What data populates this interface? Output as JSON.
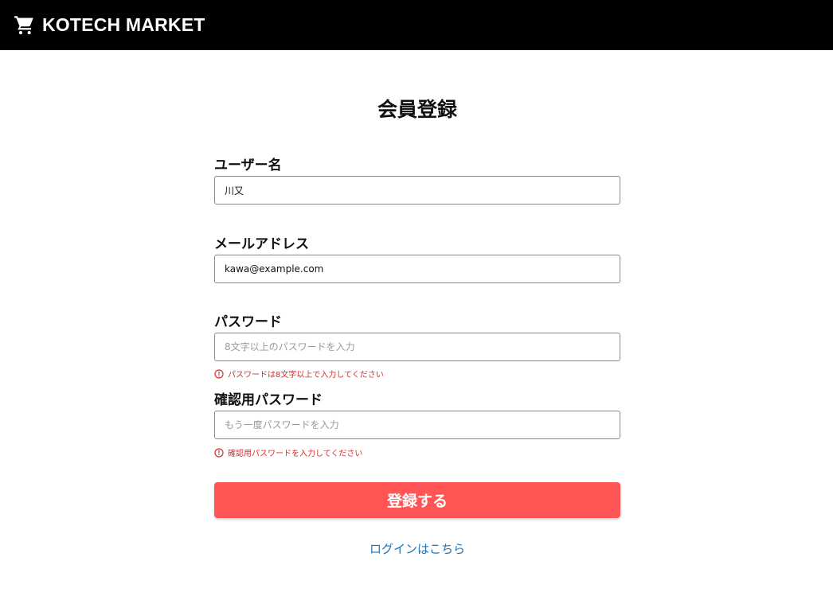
{
  "header": {
    "brand": "KOTECH MARKET",
    "icon": "cart-icon"
  },
  "form": {
    "title": "会員登録",
    "username": {
      "label": "ユーザー名",
      "value": "川又",
      "placeholder": ""
    },
    "email": {
      "label": "メールアドレス",
      "value": "kawa@example.com",
      "placeholder": ""
    },
    "password": {
      "label": "パスワード",
      "value": "",
      "placeholder": "8文字以上のパスワードを入力",
      "error": "パスワードは8文字以上で入力してください"
    },
    "confirm_password": {
      "label": "確認用パスワード",
      "value": "",
      "placeholder": "もう一度パスワードを入力",
      "error": "確認用パスワードを入力してください"
    },
    "submit_label": "登録する",
    "login_link": "ログインはこちら"
  },
  "colors": {
    "header_bg": "#000000",
    "submit_bg": "#ff5555",
    "error": "#d32f2f",
    "link": "#1a73b8"
  }
}
